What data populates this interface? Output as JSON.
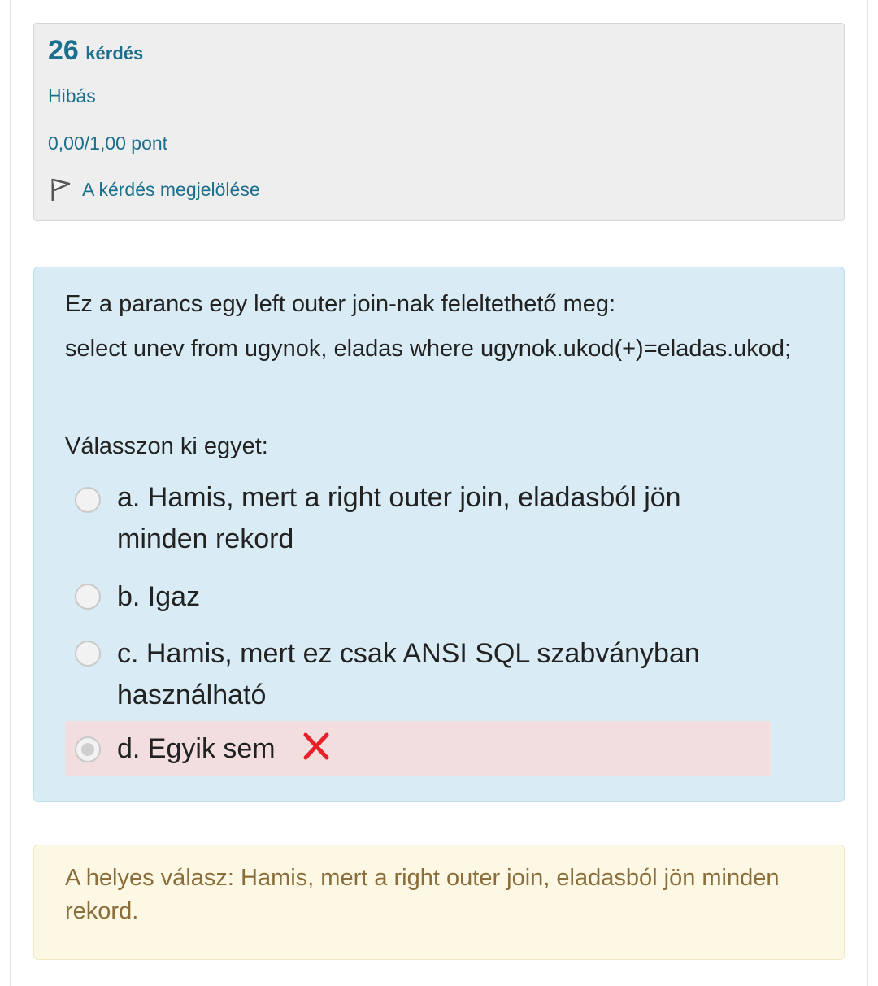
{
  "info": {
    "number": "26",
    "number_label": "kérdés",
    "state": "Hibás",
    "grade": "0,00/1,00 pont",
    "flag_label": "A kérdés megjelölése"
  },
  "question": {
    "text_lines": [
      "Ez a parancs egy left outer join-nak feleltethető meg:",
      "select unev from ugynok, eladas where ugynok.ukod(+)=eladas.ukod;"
    ],
    "prompt": "Válasszon ki egyet:",
    "options": [
      {
        "label": "a. Hamis, mert a right outer join, eladasból jön minden rekord",
        "selected": false
      },
      {
        "label": "b. Igaz",
        "selected": false
      },
      {
        "label": "c. Hamis, mert ez csak ANSI SQL szabványban használható",
        "selected": false
      },
      {
        "label": "d. Egyik sem",
        "selected": true,
        "incorrect_icon": "red-x-icon"
      }
    ]
  },
  "feedback": {
    "right_answer": "A helyes válasz: Hamis, mert a right outer join, eladasból jön minden rekord."
  },
  "colors": {
    "accent": "#1a6f8c",
    "question_bg": "#d9ecf5",
    "incorrect_bg": "#f2dede",
    "feedback_bg": "#fcf8e3",
    "feedback_text": "#8a6d3b",
    "incorrect_mark": "#e8202a"
  }
}
